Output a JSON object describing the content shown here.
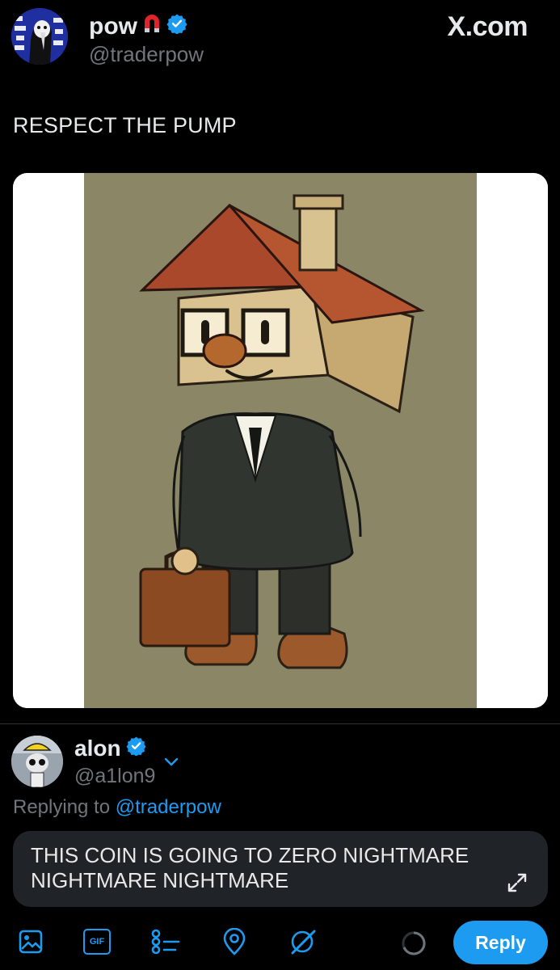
{
  "tweet": {
    "author_name": "pow",
    "author_handle": "@traderpow",
    "site": "X.com",
    "text": "RESPECT THE PUMP"
  },
  "reply_author": {
    "name": "alon",
    "handle": "@a1lon9",
    "replying_prefix": "Replying to",
    "replying_to": "@traderpow"
  },
  "composer": {
    "text": "THIS COIN IS GOING TO ZERO NIGHTMARE NIGHTMARE NIGHTMARE"
  },
  "toolbar": {
    "gif_label": "GIF",
    "reply_label": "Reply",
    "icons": [
      "image-icon",
      "gif-icon",
      "poll-icon",
      "location-icon",
      "grok-icon"
    ]
  },
  "colors": {
    "accent": "#1d9bf0",
    "background": "#000000",
    "muted": "#71767b",
    "composer_bg": "#202327"
  }
}
